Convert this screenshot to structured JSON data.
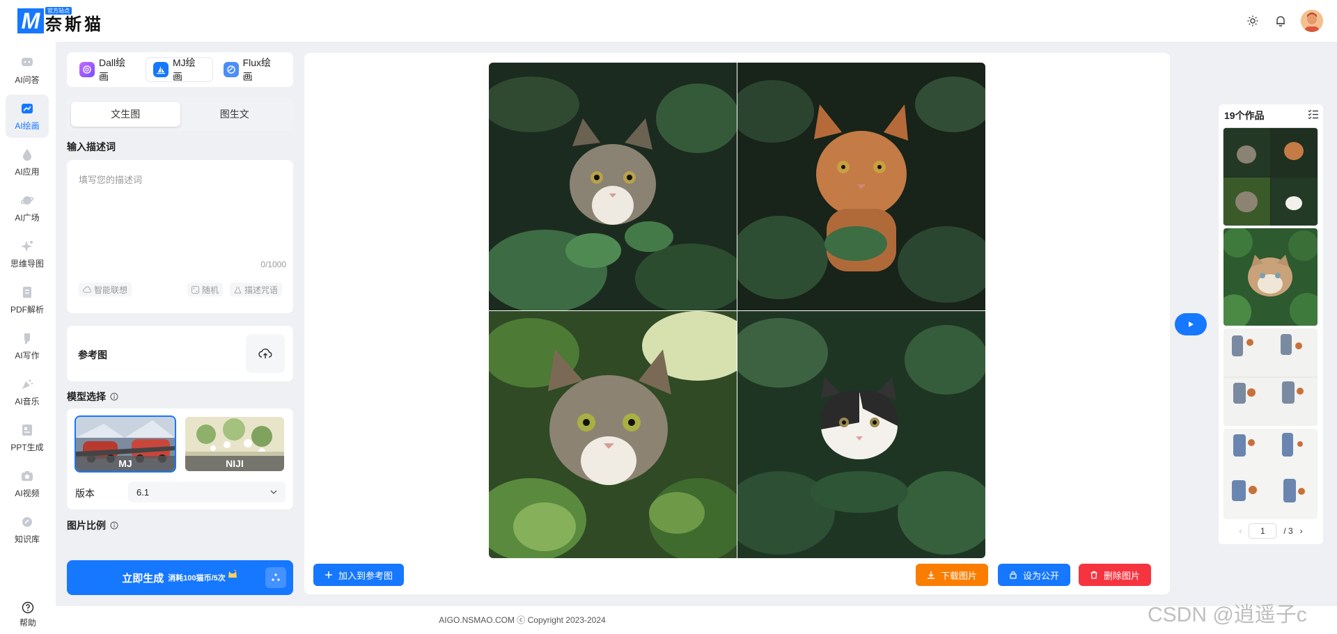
{
  "brand": {
    "logo_letter": "M",
    "tag": "官方站点",
    "name": "奈斯猫"
  },
  "nav": [
    {
      "label": "AI问答",
      "icon": "chat-bubble-icon",
      "active": false
    },
    {
      "label": "AI绘画",
      "icon": "painting-icon",
      "active": true
    },
    {
      "label": "AI应用",
      "icon": "drop-icon",
      "active": false
    },
    {
      "label": "AI广场",
      "icon": "planet-icon",
      "active": false
    },
    {
      "label": "思维导图",
      "icon": "sparkle-icon",
      "active": false
    },
    {
      "label": "PDF解析",
      "icon": "document-icon",
      "active": false
    },
    {
      "label": "AI写作",
      "icon": "writing-icon",
      "active": false
    },
    {
      "label": "AI音乐",
      "icon": "music-icon",
      "active": false
    },
    {
      "label": "PPT生成",
      "icon": "presentation-icon",
      "active": false
    },
    {
      "label": "AI视频",
      "icon": "camera-icon",
      "active": false
    },
    {
      "label": "知识库",
      "icon": "knowledge-icon",
      "active": false
    }
  ],
  "help": {
    "label": "帮助"
  },
  "model_tabs": [
    {
      "label": "Dall绘画"
    },
    {
      "label": "MJ绘画"
    },
    {
      "label": "Flux绘画"
    }
  ],
  "mode_tabs": {
    "text_to_image": "文生图",
    "image_to_text": "图生文"
  },
  "prompt": {
    "label": "输入描述词",
    "placeholder": "填写您的描述词",
    "counter": "0/1000",
    "smart": "智能联想",
    "random": "随机",
    "spell": "描述咒语"
  },
  "reference": {
    "label": "参考图"
  },
  "model": {
    "label": "模型选择",
    "options": [
      {
        "name": "MJ"
      },
      {
        "name": "NIJI"
      }
    ],
    "version_label": "版本",
    "version": "6.1"
  },
  "ratio": {
    "label": "图片比例"
  },
  "generate": {
    "label": "立即生成",
    "cost": "消耗100猫币/5次"
  },
  "actions": {
    "add_ref": "加入到参考图",
    "download": "下载图片",
    "public": "设为公开",
    "delete": "删除图片"
  },
  "works": {
    "title": "19个作品",
    "page": "1",
    "total": "/ 3"
  },
  "footer": {
    "text": "AIGO.NSMAO.COM ⓒ Copyright 2023-2024"
  },
  "watermark": "CSDN @逍遥子c",
  "colors": {
    "primary": "#1677ff",
    "orange": "#fa7d00",
    "red": "#f5343f"
  }
}
